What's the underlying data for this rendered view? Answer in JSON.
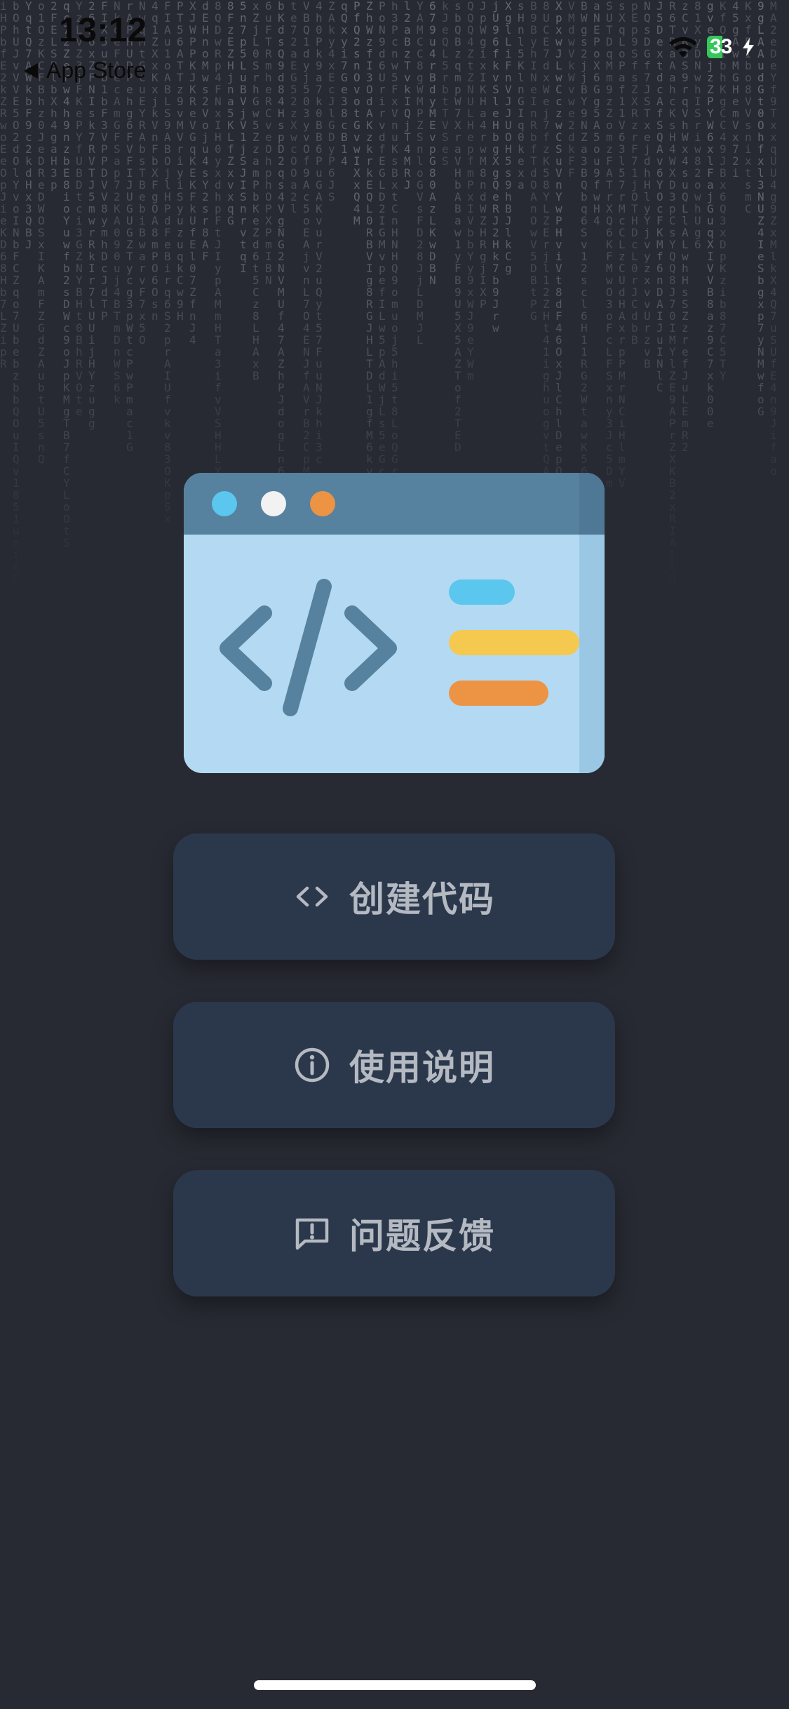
{
  "status_bar": {
    "time": "13:12",
    "back_label": "App Store",
    "battery_level": "33",
    "icons": [
      "wifi-icon",
      "battery-icon",
      "charging-bolt-icon"
    ]
  },
  "illustration": {
    "icons": [
      "code-window-illustration"
    ],
    "colors": {
      "window_body": "#b3daf2",
      "window_header": "#56829f",
      "dot_blue": "#5bc6ee",
      "dot_white": "#f2f2f2",
      "dot_orange": "#ed9344",
      "bar_blue": "#5bc6ee",
      "bar_yellow": "#f5c850",
      "bar_orange": "#ed9344",
      "code_symbol": "#56829f"
    }
  },
  "menu": {
    "items": [
      {
        "label": "创建代码",
        "icon": "code-brackets-icon"
      },
      {
        "label": "使用说明",
        "icon": "info-icon"
      },
      {
        "label": "问题反馈",
        "icon": "feedback-icon"
      }
    ]
  },
  "theme": {
    "background": "#282a33",
    "button_background": "#2b384b",
    "button_text": "#b4b9c2"
  }
}
